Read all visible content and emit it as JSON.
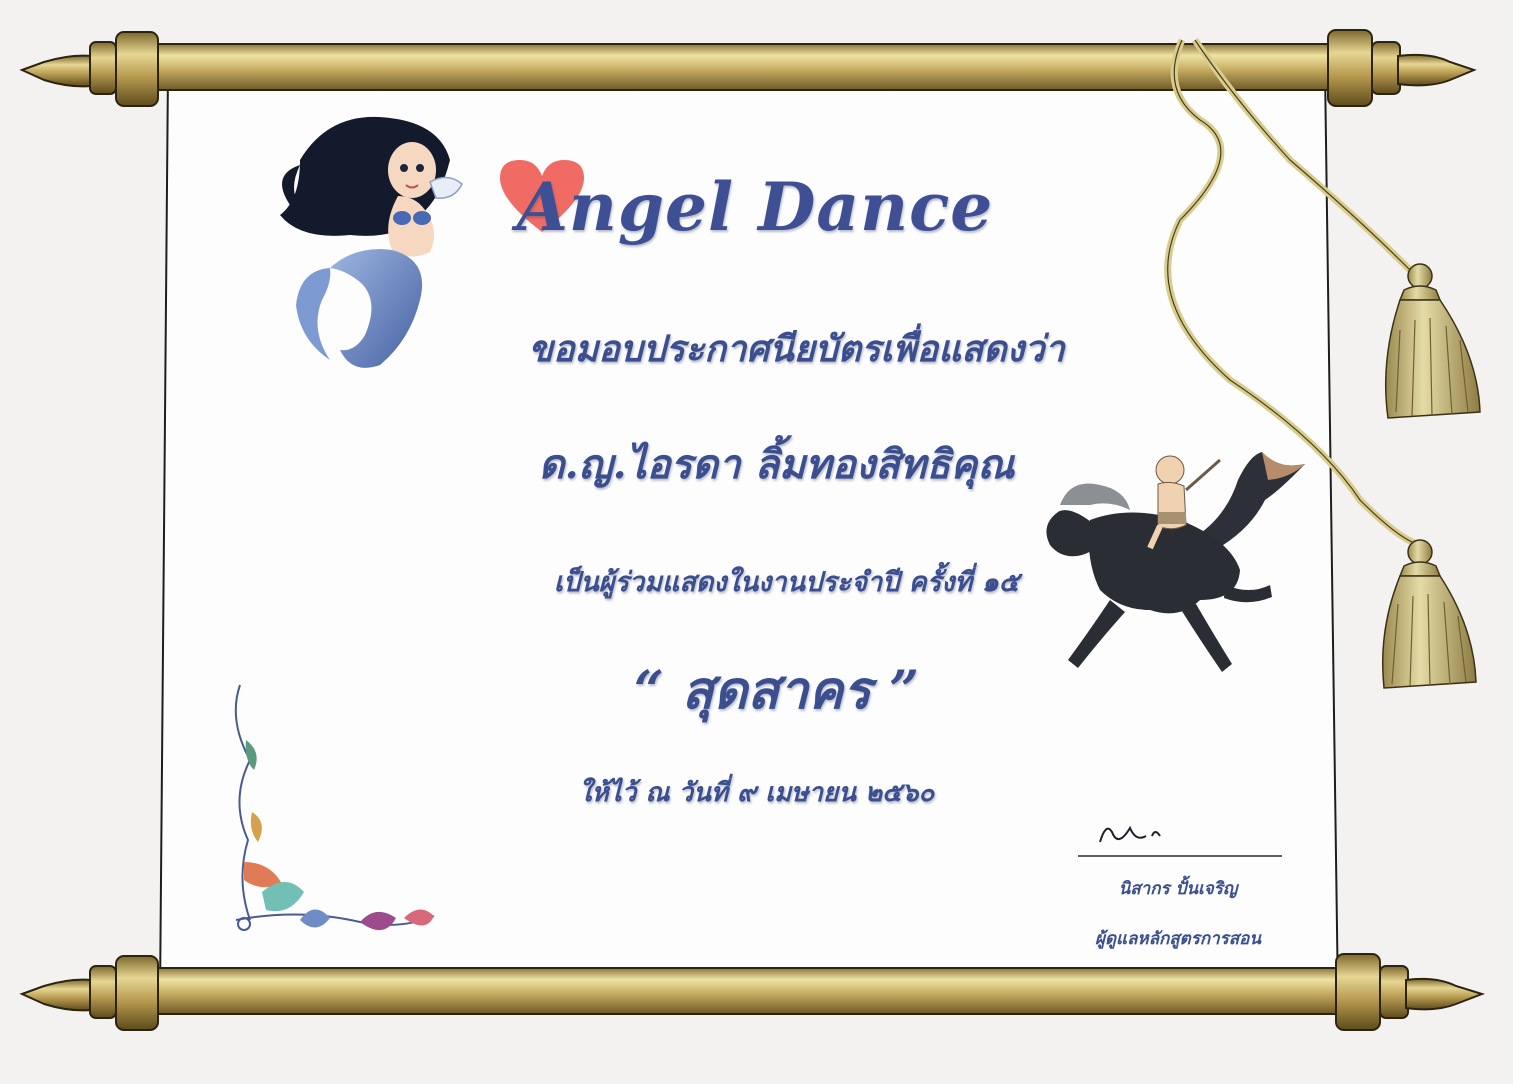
{
  "certificate": {
    "title": "Angel Dance",
    "line1": "ขอมอบประกาศนียบัตรเพื่อแสดงว่า",
    "recipient": "ด.ญ.ไอรดา ลิ้มทองสิทธิคุณ",
    "line2": "เป็นผู้ร่วมแสดงในงานประจำปี ครั้งที่ ๑๕",
    "event_title": "“ สุดสาคร ”",
    "date": "ให้ไว้ ณ วันที่ ๙ เมษายน ๒๕๖๐",
    "signer_name": "นิสากร ปั้นเจริญ",
    "signer_role": "ผู้ดูแลหลักสูตรการสอน"
  },
  "colors": {
    "text": "#3b4f8f",
    "scroll_gold": "#c9b26a",
    "heart": "#ef6b63",
    "paper": "#fbfbfb"
  },
  "decorations": [
    "mermaid-illustration",
    "heart-icon",
    "boy-on-sea-horse-illustration",
    "tassel-cord",
    "thai-corner-ornament",
    "signature"
  ]
}
